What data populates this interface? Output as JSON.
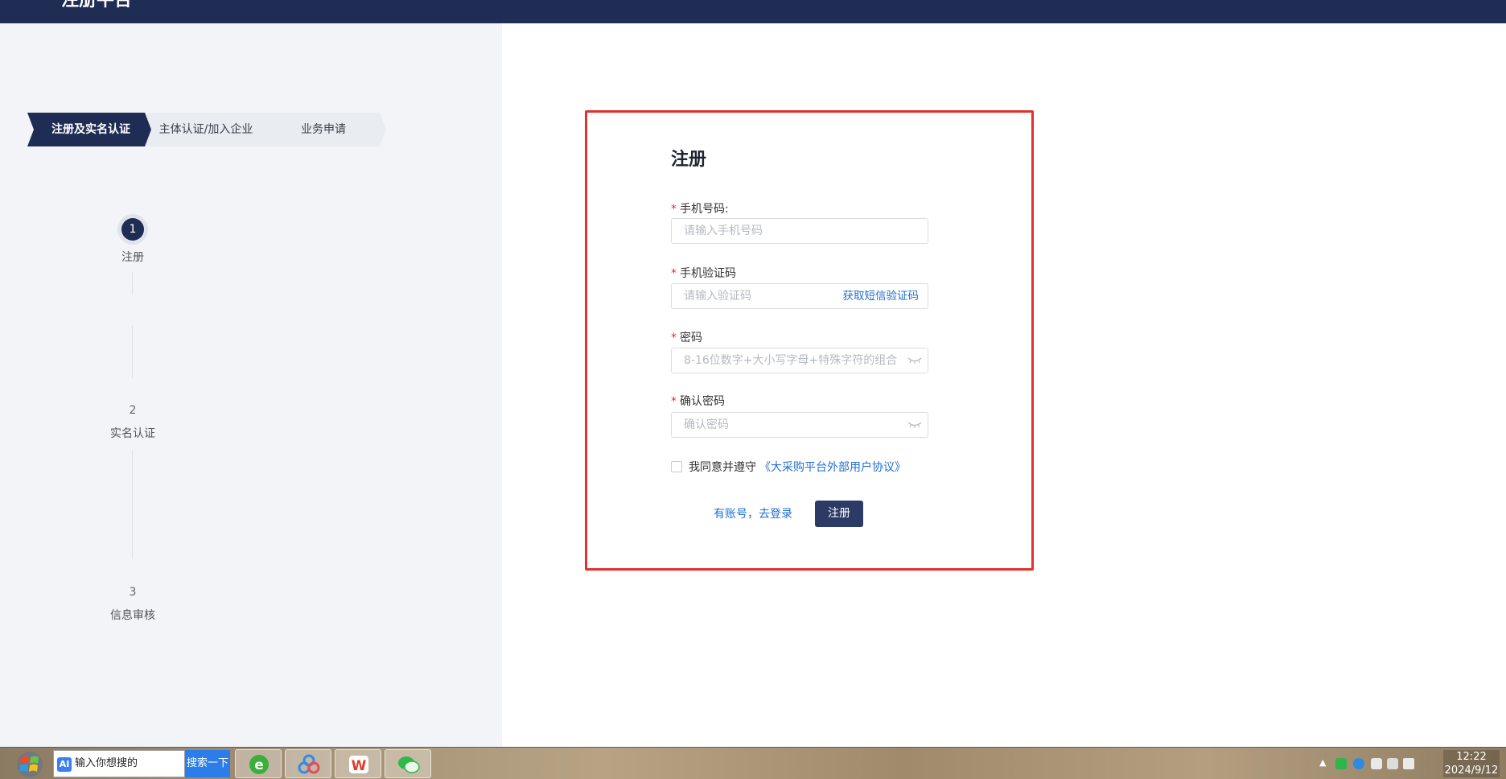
{
  "header": {
    "title": "注册平台"
  },
  "stepbar": {
    "items": [
      {
        "label": "注册及实名认证",
        "active": true
      },
      {
        "label": "主体认证/加入企业",
        "active": false
      },
      {
        "label": "业务申请",
        "active": false
      }
    ]
  },
  "vsteps": [
    {
      "num": "1",
      "label": "注册",
      "active": true
    },
    {
      "num": "2",
      "label": "实名认证",
      "active": false
    },
    {
      "num": "3",
      "label": "信息审核",
      "active": false
    }
  ],
  "form": {
    "title": "注册",
    "required_mark": "*",
    "phone": {
      "label": "手机号码:",
      "placeholder": "请输入手机号码"
    },
    "code": {
      "label": "手机验证码",
      "placeholder": "请输入验证码",
      "action": "获取短信验证码"
    },
    "password": {
      "label": "密码",
      "placeholder": "8-16位数字+大小写字母+特殊字符的组合"
    },
    "confirm": {
      "label": "确认密码",
      "placeholder": "确认密码"
    },
    "agreement": {
      "text": "我同意并遵守",
      "link": "《大采购平台外部用户协议》"
    },
    "login_link": "有账号，去登录",
    "submit": "注册"
  },
  "taskbar": {
    "search_icon_text": "AI",
    "search_text": "输入你想搜的",
    "search_button": "搜索一下",
    "apps": [
      "browser-icon",
      "cloud-drive-icon",
      "wps-icon",
      "wechat-icon"
    ],
    "clock": {
      "time": "12:22",
      "date": "2024/9/12"
    }
  },
  "colors": {
    "header_bg": "#1f2d54",
    "accent": "#2c3a66",
    "link": "#1f6fd0",
    "highlight_border": "#e2302d"
  }
}
